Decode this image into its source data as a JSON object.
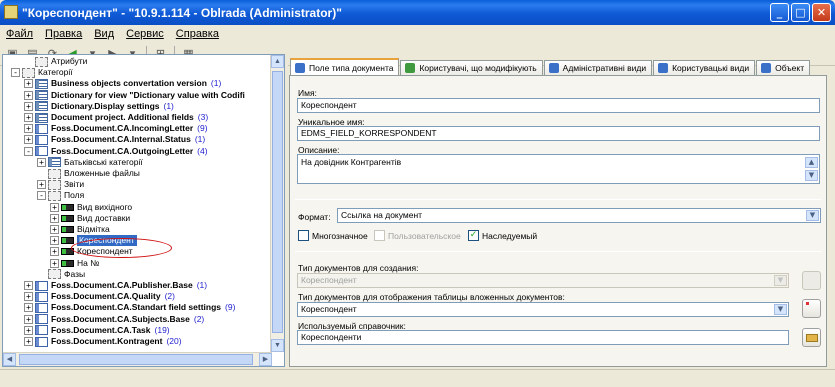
{
  "window": {
    "title": "\"Кореспондент\" - \"10.9.1.114 - Oblrada (Administrator)\""
  },
  "menu": [
    "Файл",
    "Правка",
    "Вид",
    "Сервис",
    "Справка"
  ],
  "tree": [
    {
      "label": "Атрибути",
      "indent": 2,
      "exp": "",
      "icon": "gen",
      "bold": false
    },
    {
      "label": "Категорії",
      "indent": 1,
      "exp": "-",
      "icon": "gen",
      "bold": false
    },
    {
      "label": "Business objects convertation version",
      "count": "(1)",
      "indent": 2,
      "exp": "+",
      "icon": "cat",
      "bold": true
    },
    {
      "label": "Dictionary for view \"Dictionary value with Codifi",
      "indent": 2,
      "exp": "+",
      "icon": "cat",
      "bold": true
    },
    {
      "label": "Dictionary.Display settings",
      "count": "(1)",
      "indent": 2,
      "exp": "+",
      "icon": "cat",
      "bold": true
    },
    {
      "label": "Document project. Additional fields",
      "count": "(3)",
      "indent": 2,
      "exp": "+",
      "icon": "cat",
      "bold": true
    },
    {
      "label": "Foss.Document.CA.IncomingLetter",
      "count": "(9)",
      "indent": 2,
      "exp": "+",
      "icon": "doc",
      "bold": true
    },
    {
      "label": "Foss.Document.CA.Internal.Status",
      "count": "(1)",
      "indent": 2,
      "exp": "+",
      "icon": "doc",
      "bold": true
    },
    {
      "label": "Foss.Document.CA.OutgoingLetter",
      "count": "(4)",
      "indent": 2,
      "exp": "-",
      "icon": "doc",
      "bold": true
    },
    {
      "label": "Батьківські категорії",
      "indent": 3,
      "exp": "+",
      "icon": "cat",
      "bold": false
    },
    {
      "label": "Вложенные файлы",
      "indent": 3,
      "exp": "",
      "icon": "gen",
      "bold": false
    },
    {
      "label": "Звіти",
      "indent": 3,
      "exp": "+",
      "icon": "gen",
      "bold": false
    },
    {
      "label": "Поля",
      "indent": 3,
      "exp": "-",
      "icon": "gen",
      "bold": false
    },
    {
      "label": "Вид вихідного",
      "indent": 4,
      "exp": "+",
      "icon": "fld",
      "bold": false
    },
    {
      "label": "Вид доставки",
      "indent": 4,
      "exp": "+",
      "icon": "fld",
      "bold": false
    },
    {
      "label": "Відмітка",
      "indent": 4,
      "exp": "+",
      "icon": "fld",
      "bold": false
    },
    {
      "label": "Кореспондент",
      "indent": 4,
      "exp": "+",
      "icon": "fld",
      "bold": false,
      "selected": true
    },
    {
      "label": "Кореспондент",
      "indent": 4,
      "exp": "+",
      "icon": "fld",
      "bold": false
    },
    {
      "label": "На №",
      "indent": 4,
      "exp": "+",
      "icon": "fld",
      "bold": false
    },
    {
      "label": "Фазы",
      "indent": 3,
      "exp": "",
      "icon": "gen",
      "bold": false
    },
    {
      "label": "Foss.Document.CA.Publisher.Base",
      "count": "(1)",
      "indent": 2,
      "exp": "+",
      "icon": "doc",
      "bold": true
    },
    {
      "label": "Foss.Document.CA.Quality",
      "count": "(2)",
      "indent": 2,
      "exp": "+",
      "icon": "doc",
      "bold": true
    },
    {
      "label": "Foss.Document.CA.Standart field settings",
      "count": "(9)",
      "indent": 2,
      "exp": "+",
      "icon": "doc",
      "bold": true
    },
    {
      "label": "Foss.Document.CA.Subjects.Base",
      "count": "(2)",
      "indent": 2,
      "exp": "+",
      "icon": "doc",
      "bold": true
    },
    {
      "label": "Foss.Document.CA.Task",
      "count": "(19)",
      "indent": 2,
      "exp": "+",
      "icon": "doc",
      "bold": true
    },
    {
      "label": "Foss.Document.Kontragent",
      "count": "(20)",
      "indent": 2,
      "exp": "+",
      "icon": "doc",
      "bold": true
    }
  ],
  "tabs": [
    {
      "label": "Поле типа документа",
      "color": "#3a70c8"
    },
    {
      "label": "Користувачі, що модифікують",
      "color": "#3f9a3f"
    },
    {
      "label": "Адміністративні види",
      "color": "#3a70c8"
    },
    {
      "label": "Користувацькі види",
      "color": "#3a70c8"
    },
    {
      "label": "Объект",
      "color": "#3a70c8"
    }
  ],
  "form": {
    "name_label": "Имя:",
    "name_value": "Кореспондент",
    "unique_label": "Уникальное имя:",
    "unique_value": "EDMS_FIELD_KORRESPONDENT",
    "desc_label": "Описание:",
    "desc_value": "На довідник Контрагентів",
    "format_label": "Формат:",
    "format_value": "Ссылка на документ",
    "multi_label": "Многозначное",
    "user_label": "Пользовательское",
    "inherit_label": "Наследуемый",
    "create_label": "Тип документов для создания:",
    "create_value": "Кореспондент",
    "table_label": "Тип документов для отображения таблицы вложенных документов:",
    "table_value": "Кореспондент",
    "ref_label": "Используемый справочник:",
    "ref_value": "Кореспонденти"
  },
  "checkboxes": {
    "multi": false,
    "user": false,
    "inherit": true
  }
}
